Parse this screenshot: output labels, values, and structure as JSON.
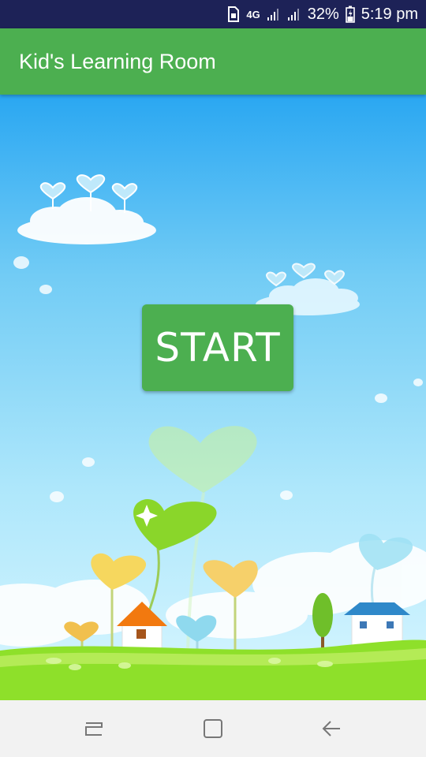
{
  "status_bar": {
    "network": "4G",
    "battery": "32%",
    "time": "5:19 pm",
    "icons": [
      "sim-icon",
      "signal-icon",
      "signal-icon",
      "battery-charging-icon"
    ]
  },
  "app_bar": {
    "title": "Kid's Learning Room"
  },
  "main": {
    "start_label": "START",
    "background": "cartoon-sky-heart-flowers-houses"
  },
  "nav_bar": {
    "icons": [
      "recent-apps-icon",
      "home-icon",
      "back-icon"
    ]
  },
  "colors": {
    "status_bar": "#1d2257",
    "app_bar": "#4caf50",
    "start_button": "#4caf50",
    "nav_bar": "#f2f2f2",
    "sky_top": "#2aa7f2",
    "grass": "#8ee02a"
  }
}
